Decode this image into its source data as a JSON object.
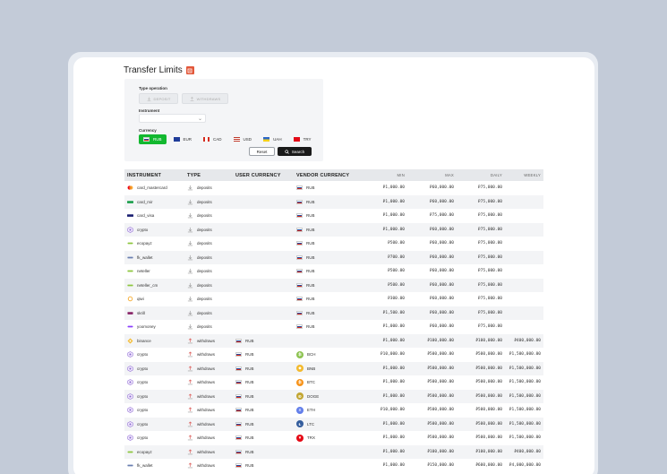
{
  "page": {
    "title": "Transfer Limits"
  },
  "filters": {
    "type_label": "Type operation",
    "deposit_label": "DEPOSIT",
    "withdraws_label": "WITHDRAWS",
    "instrument_label": "Instrument",
    "instrument_value": "",
    "currency_label": "Currency",
    "currencies": [
      {
        "code": "RUB",
        "active": true,
        "flag": "ru"
      },
      {
        "code": "EUR",
        "active": false,
        "flag": "eu"
      },
      {
        "code": "CAD",
        "active": false,
        "flag": "ca"
      },
      {
        "code": "USD",
        "active": false,
        "flag": "us"
      },
      {
        "code": "UAH",
        "active": false,
        "flag": "ua"
      },
      {
        "code": "TRY",
        "active": false,
        "flag": "tr"
      }
    ],
    "reset_label": "Reset",
    "search_label": "Search"
  },
  "table": {
    "headers": {
      "instrument": "INSTRUMENT",
      "type": "TYPE",
      "user_currency": "USER CURRENCY",
      "vendor_currency": "VENDOR CURRENCY",
      "min": "MIN",
      "max": "MAX",
      "daily": "DAILY",
      "weekly": "WEEKLY"
    },
    "rows": [
      {
        "instrument": "card_mastercard",
        "icon": "mastercard-icon",
        "type": "deposits",
        "user_currency": "",
        "vendor_currency": "RUB",
        "vendor_icon": "ru-flag",
        "min": "₽1,000.00",
        "max": "₽60,000.00",
        "daily": "₽75,000.00",
        "weekly": ""
      },
      {
        "instrument": "card_mir",
        "icon": "mir-icon",
        "type": "deposits",
        "user_currency": "",
        "vendor_currency": "RUB",
        "vendor_icon": "ru-flag",
        "min": "₽1,000.00",
        "max": "₽60,000.00",
        "daily": "₽75,000.00",
        "weekly": ""
      },
      {
        "instrument": "card_visa",
        "icon": "visa-icon",
        "type": "deposits",
        "user_currency": "",
        "vendor_currency": "RUB",
        "vendor_icon": "ru-flag",
        "min": "₽1,000.00",
        "max": "₽75,000.00",
        "daily": "₽75,000.00",
        "weekly": ""
      },
      {
        "instrument": "crypto",
        "icon": "crypto-icon",
        "type": "deposits",
        "user_currency": "",
        "vendor_currency": "RUB",
        "vendor_icon": "ru-flag",
        "min": "₽1,000.00",
        "max": "₽60,000.00",
        "daily": "₽75,000.00",
        "weekly": ""
      },
      {
        "instrument": "ecopayz",
        "icon": "ecopayz-icon",
        "type": "deposits",
        "user_currency": "",
        "vendor_currency": "RUB",
        "vendor_icon": "ru-flag",
        "min": "₽500.00",
        "max": "₽60,000.00",
        "daily": "₽75,000.00",
        "weekly": ""
      },
      {
        "instrument": "fk_wallet",
        "icon": "fkwallet-icon",
        "type": "deposits",
        "user_currency": "",
        "vendor_currency": "RUB",
        "vendor_icon": "ru-flag",
        "min": "₽700.00",
        "max": "₽60,000.00",
        "daily": "₽75,000.00",
        "weekly": ""
      },
      {
        "instrument": "neteller",
        "icon": "neteller-icon",
        "type": "deposits",
        "user_currency": "",
        "vendor_currency": "RUB",
        "vendor_icon": "ru-flag",
        "min": "₽500.00",
        "max": "₽60,000.00",
        "daily": "₽75,000.00",
        "weekly": ""
      },
      {
        "instrument": "neteller_cm",
        "icon": "neteller-icon",
        "type": "deposits",
        "user_currency": "",
        "vendor_currency": "RUB",
        "vendor_icon": "ru-flag",
        "min": "₽500.00",
        "max": "₽60,000.00",
        "daily": "₽75,000.00",
        "weekly": ""
      },
      {
        "instrument": "qiwi",
        "icon": "qiwi-icon",
        "type": "deposits",
        "user_currency": "",
        "vendor_currency": "RUB",
        "vendor_icon": "ru-flag",
        "min": "₽300.00",
        "max": "₽60,000.00",
        "daily": "₽75,000.00",
        "weekly": ""
      },
      {
        "instrument": "skrill",
        "icon": "skrill-icon",
        "type": "deposits",
        "user_currency": "",
        "vendor_currency": "RUB",
        "vendor_icon": "ru-flag",
        "min": "₽1,500.00",
        "max": "₽60,000.00",
        "daily": "₽75,000.00",
        "weekly": ""
      },
      {
        "instrument": "yoomoney",
        "icon": "yoomoney-icon",
        "type": "deposits",
        "user_currency": "",
        "vendor_currency": "RUB",
        "vendor_icon": "ru-flag",
        "min": "₽1,000.00",
        "max": "₽60,000.00",
        "daily": "₽75,000.00",
        "weekly": ""
      },
      {
        "instrument": "binance",
        "icon": "binance-icon",
        "type": "withdraws",
        "user_currency": "RUB",
        "vendor_currency": "",
        "vendor_icon": "",
        "min": "₽1,000.00",
        "max": "₽100,000.00",
        "daily": "₽100,000.00",
        "weekly": "₽400,000.00"
      },
      {
        "instrument": "crypto",
        "icon": "crypto-icon",
        "type": "withdraws",
        "user_currency": "RUB",
        "vendor_currency": "BCH",
        "vendor_icon": "bch-coin",
        "min": "₽10,000.00",
        "max": "₽500,000.00",
        "daily": "₽500,000.00",
        "weekly": "₽1,500,000.00"
      },
      {
        "instrument": "crypto",
        "icon": "crypto-icon",
        "type": "withdraws",
        "user_currency": "RUB",
        "vendor_currency": "BNB",
        "vendor_icon": "bnb-coin",
        "min": "₽1,000.00",
        "max": "₽500,000.00",
        "daily": "₽500,000.00",
        "weekly": "₽1,500,000.00"
      },
      {
        "instrument": "crypto",
        "icon": "crypto-icon",
        "type": "withdraws",
        "user_currency": "RUB",
        "vendor_currency": "BTC",
        "vendor_icon": "btc-coin",
        "min": "₽1,000.00",
        "max": "₽500,000.00",
        "daily": "₽500,000.00",
        "weekly": "₽1,500,000.00"
      },
      {
        "instrument": "crypto",
        "icon": "crypto-icon",
        "type": "withdraws",
        "user_currency": "RUB",
        "vendor_currency": "DOGE",
        "vendor_icon": "doge-coin",
        "min": "₽1,000.00",
        "max": "₽500,000.00",
        "daily": "₽500,000.00",
        "weekly": "₽1,500,000.00"
      },
      {
        "instrument": "crypto",
        "icon": "crypto-icon",
        "type": "withdraws",
        "user_currency": "RUB",
        "vendor_currency": "ETH",
        "vendor_icon": "eth-coin",
        "min": "₽10,000.00",
        "max": "₽500,000.00",
        "daily": "₽500,000.00",
        "weekly": "₽1,500,000.00"
      },
      {
        "instrument": "crypto",
        "icon": "crypto-icon",
        "type": "withdraws",
        "user_currency": "RUB",
        "vendor_currency": "LTC",
        "vendor_icon": "ltc-coin",
        "min": "₽1,000.00",
        "max": "₽500,000.00",
        "daily": "₽500,000.00",
        "weekly": "₽1,500,000.00"
      },
      {
        "instrument": "crypto",
        "icon": "crypto-icon",
        "type": "withdraws",
        "user_currency": "RUB",
        "vendor_currency": "TRX",
        "vendor_icon": "trx-coin",
        "min": "₽1,000.00",
        "max": "₽500,000.00",
        "daily": "₽500,000.00",
        "weekly": "₽1,500,000.00"
      },
      {
        "instrument": "ecopayz",
        "icon": "ecopayz-icon",
        "type": "withdraws",
        "user_currency": "RUB",
        "vendor_currency": "",
        "vendor_icon": "",
        "min": "₽1,000.00",
        "max": "₽100,000.00",
        "daily": "₽100,000.00",
        "weekly": "₽400,000.00"
      },
      {
        "instrument": "fk_wallet",
        "icon": "fkwallet-icon",
        "type": "withdraws",
        "user_currency": "RUB",
        "vendor_currency": "",
        "vendor_icon": "",
        "min": "₽1,000.00",
        "max": "₽150,000.00",
        "daily": "₽600,000.00",
        "weekly": "₽4,000,000.00"
      }
    ]
  },
  "colors": {
    "accent_green": "#12b82f",
    "title_icon": "#e2583a",
    "search_button": "#1a1a1a",
    "header_bg": "#e6e8eb"
  }
}
